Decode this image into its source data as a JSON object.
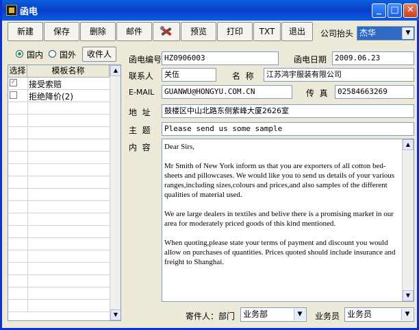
{
  "window": {
    "title": "函电"
  },
  "titlebar_buttons": {
    "minimize": "_",
    "maximize": "□",
    "close": "✕"
  },
  "toolbar": {
    "new": "新建",
    "save": "保存",
    "delete": "删除",
    "mail": "邮件",
    "preview": "预览",
    "print": "打印",
    "txt": "TXT",
    "exit": "退出",
    "tools_icon": "tools-icon"
  },
  "company_header": {
    "label": "公司抬头",
    "value": "杰华"
  },
  "scope": {
    "domestic": "国内",
    "foreign": "国外",
    "selected": "domestic",
    "recipient_button": "收件人"
  },
  "template_grid": {
    "headers": [
      "选择",
      "模板名称"
    ],
    "rows": [
      {
        "checked": true,
        "name": "接受索赔"
      },
      {
        "checked": false,
        "name": "拒绝降价(2)"
      }
    ]
  },
  "form": {
    "letter_no_label": "函电编号",
    "letter_no": "HZ0906003",
    "letter_date_label": "函电日期",
    "letter_date": "2009.06.23",
    "contact_label": "联系人",
    "contact": "关伍",
    "name_label": "名  称",
    "name": "江苏鸿宇服装有限公司",
    "email_label": "E-MAIL",
    "email": "GUANWU@HONGYU.COM.CN",
    "fax_label": "传  真",
    "fax": "02584663269",
    "address_label": "地  址",
    "address": "鼓楼区中山北路东侧紫峰大厦2626室",
    "subject_label": "主  题",
    "subject": "Please send us some sample",
    "content_label": "内  容",
    "content": "Dear Sirs,\n\nMr Smith of New York inform us that you are exporters of all cotton bed-sheets and pillowcases. We would like you to send us details of your various ranges,including sizes,colours and prices,and also samples of the different qualities of material used.\n\nWe are large dealers in textiles and belive there is a promising market in our area for moderately priced goods of this kind mentioned.\n\nWhen quoting,please state your terms of payment and discount you would allow on purchases of quantities. Prices quoted should include insurance and freight to Shanghai."
  },
  "footer": {
    "sender_label": "寄件人：部门",
    "department": "业务部",
    "staff_label": "业务员",
    "staff": "业务员"
  },
  "colors": {
    "titlebar": "#0A5FDD",
    "accent_select": "#316AC5",
    "window_bg": "#ECE9D8"
  }
}
